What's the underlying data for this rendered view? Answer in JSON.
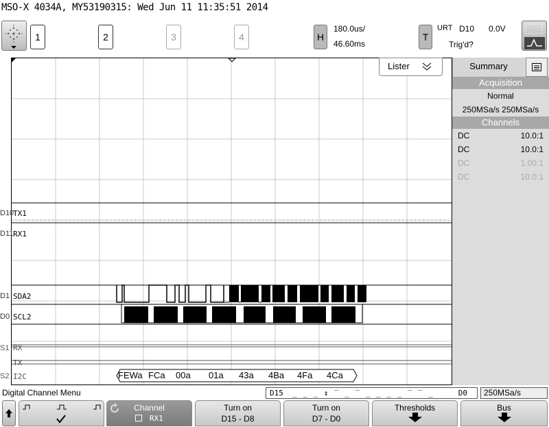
{
  "title": "MSO-X 4034A, MY53190315: Wed Jun 11 11:35:51 2014",
  "toolbar": {
    "channels": [
      "1",
      "2",
      "3",
      "4"
    ],
    "horiz_btn": "H",
    "time_per_div": "180.0us/",
    "delay": "46.60ms",
    "trig_btn": "T",
    "trig_mode": "URT",
    "trig_source": "D10",
    "trig_level": "0.0V",
    "trig_status": "Trig'd?"
  },
  "lister": {
    "label": "Lister"
  },
  "summary": {
    "tab_label": "Summary",
    "acquisition_head": "Acquisition",
    "acq_mode": "Normal",
    "sample_rate": "250MSa/s 250MSa/s",
    "channels_head": "Channels",
    "channels": [
      {
        "coupling": "DC",
        "probe": "10.0:1",
        "active": true
      },
      {
        "coupling": "DC",
        "probe": "10.0:1",
        "active": true
      },
      {
        "coupling": "DC",
        "probe": "1.00:1",
        "active": false
      },
      {
        "coupling": "DC",
        "probe": "10.0:1",
        "active": false
      }
    ]
  },
  "digital": {
    "d10": {
      "id": "D10",
      "name": "TX1"
    },
    "d11": {
      "id": "D11",
      "name": "RX1"
    },
    "d1": {
      "id": "D1",
      "name": "SDA2"
    },
    "d0": {
      "id": "D0",
      "name": "SCL2"
    }
  },
  "serial": {
    "s1": {
      "id": "S1",
      "rx": "RX",
      "tx": "TX"
    },
    "s2": {
      "id": "S2",
      "name": "I2C"
    },
    "i2c_packets": [
      "FEWa",
      "FCa",
      "00a",
      "01a",
      "43a",
      "4Ba",
      "4Fa",
      "4Ca"
    ]
  },
  "status_bar": {
    "menu_title": "Digital Channel Menu",
    "d15": "D15",
    "d0": "D0",
    "sample_rate": "250MSa/s"
  },
  "softkeys": {
    "channel_label": "Channel",
    "channel_value": "RX1",
    "turn_on_high_l1": "Turn on",
    "turn_on_high_l2": "D15 - D8",
    "turn_on_low_l1": "Turn on",
    "turn_on_low_l2": "D7 - D0",
    "thresholds": "Thresholds",
    "bus": "Bus"
  },
  "colors": {
    "sidebar_bg": "#dcdcdc",
    "sidebar_head": "#a8a8a8",
    "grid_line": "#c8c8c8"
  }
}
